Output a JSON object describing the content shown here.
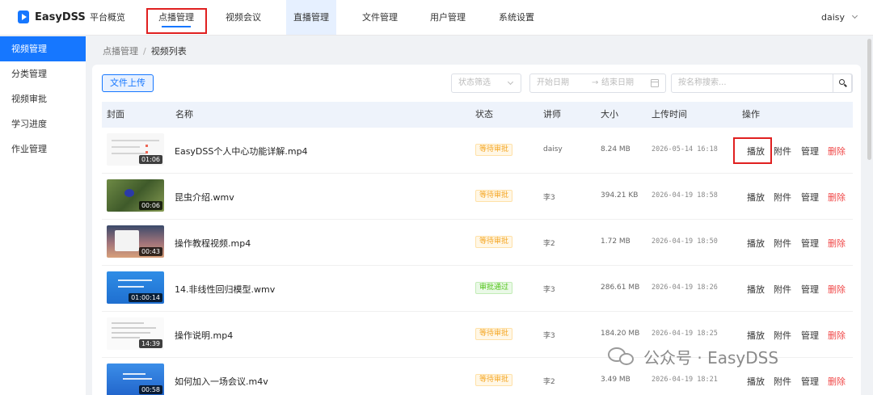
{
  "app": {
    "name": "EasyDSS"
  },
  "nav": {
    "items": [
      {
        "label": "平台概览"
      },
      {
        "label": "点播管理"
      },
      {
        "label": "视频会议"
      },
      {
        "label": "直播管理"
      },
      {
        "label": "文件管理"
      },
      {
        "label": "用户管理"
      },
      {
        "label": "系统设置"
      }
    ],
    "active_index": 1,
    "highlighted_index": 3,
    "user": "daisy"
  },
  "sidebar": {
    "items": [
      {
        "label": "视频管理"
      },
      {
        "label": "分类管理"
      },
      {
        "label": "视频审批"
      },
      {
        "label": "学习进度"
      },
      {
        "label": "作业管理"
      }
    ],
    "active_index": 0
  },
  "breadcrumb": {
    "parent": "点播管理",
    "separator": "/",
    "current": "视频列表"
  },
  "toolbar": {
    "upload_label": "文件上传",
    "status_placeholder": "状态筛选",
    "start_date_placeholder": "开始日期",
    "date_arrow": "→",
    "end_date_placeholder": "结束日期",
    "search_placeholder": "按名称搜索..."
  },
  "table": {
    "headers": {
      "cover": "封面",
      "name": "名称",
      "status": "状态",
      "lecturer": "讲师",
      "size": "大小",
      "upload_time": "上传时间",
      "actions": "操作"
    },
    "action_labels": {
      "play": "播放",
      "attach": "附件",
      "manage": "管理",
      "delete": "删除"
    },
    "rows": [
      {
        "duration": "01:06",
        "name": "EasyDSS个人中心功能详解.mp4",
        "status": "等待审批",
        "status_type": "pending",
        "lecturer": "daisy",
        "size": "8.24 MB",
        "time": "2026-05-14 16:18"
      },
      {
        "duration": "00:06",
        "name": "昆虫介绍.wmv",
        "status": "等待审批",
        "status_type": "pending",
        "lecturer": "李3",
        "size": "394.21 KB",
        "time": "2026-04-19 18:58"
      },
      {
        "duration": "00:43",
        "name": "操作教程视频.mp4",
        "status": "等待审批",
        "status_type": "pending",
        "lecturer": "李2",
        "size": "1.72 MB",
        "time": "2026-04-19 18:50"
      },
      {
        "duration": "01:00:14",
        "name": "14.非线性回归模型.wmv",
        "status": "审批通过",
        "status_type": "passed",
        "lecturer": "李3",
        "size": "286.61 MB",
        "time": "2026-04-19 18:26"
      },
      {
        "duration": "14:39",
        "name": "操作说明.mp4",
        "status": "等待审批",
        "status_type": "pending",
        "lecturer": "李3",
        "size": "184.20 MB",
        "time": "2026-04-19 18:25"
      },
      {
        "duration": "00:58",
        "name": "如何加入一场会议.m4v",
        "status": "等待审批",
        "status_type": "pending",
        "lecturer": "李2",
        "size": "3.49 MB",
        "time": "2026-04-19 18:21"
      }
    ]
  },
  "watermark": {
    "text": "公众号 · EasyDSS"
  },
  "colors": {
    "primary": "#1677ff",
    "danger": "#f04848",
    "pending": "#f5a623",
    "passed": "#52c41a",
    "highlight_box": "#e02020"
  }
}
